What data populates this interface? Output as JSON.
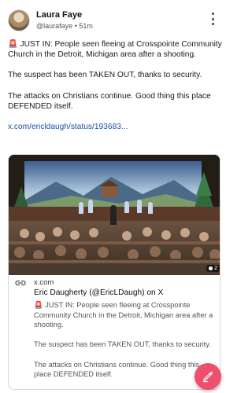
{
  "post": {
    "author_name": "Laura Faye",
    "author_handle": "@laurafaye",
    "separator": "•",
    "timestamp": "51m",
    "paragraphs": [
      "🚨 JUST IN: People seen fleeing at Crosspointe Community Church in the Detroit, Michigan area after a shooting.",
      "The suspect has been TAKEN OUT, thanks to security.",
      "The attacks on Christians continue. Good thing this place DEFENDED itself."
    ],
    "link_text": "x.com/ericldaugh/status/193683..."
  },
  "card": {
    "domain": "x.com",
    "title": "Eric Daugherty (@EricLDaugh) on X",
    "description": [
      "🚨 JUST IN: People seen fleeing at Crosspointe Community Church in the Detroit, Michigan area after a shooting.",
      "The suspect has been TAKEN OUT, thanks to security.",
      "The attacks on Christians continue. Good thing this place DEFENDED itself."
    ],
    "badge_text": "2"
  },
  "icons": {
    "more": "more-vertical-icon",
    "link": "link-icon",
    "compose": "edit-pencil-icon"
  },
  "colors": {
    "link": "#1d4fa8",
    "fab": "#ef4f6e"
  }
}
